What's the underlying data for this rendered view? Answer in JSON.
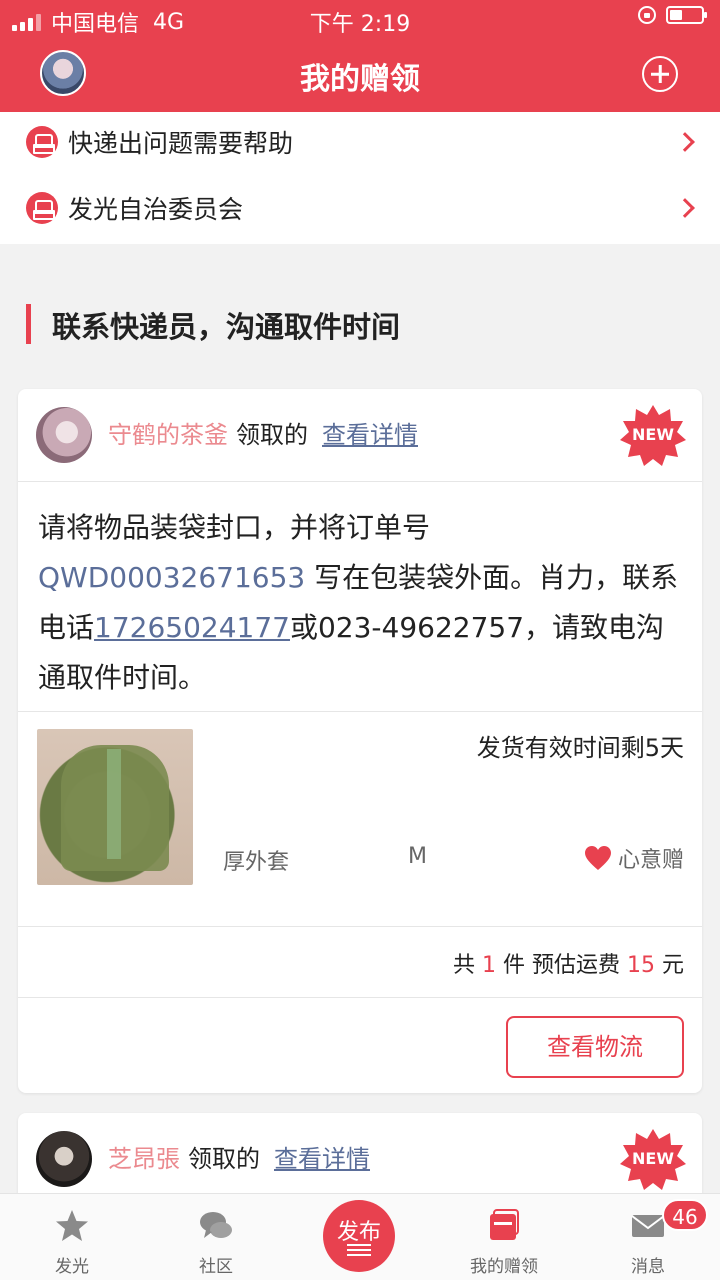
{
  "status_bar": {
    "carrier": "中国电信",
    "network": "4G",
    "time": "下午 2:19"
  },
  "header": {
    "title": "我的赠领",
    "left_icon": "user-avatar",
    "right_icon": "add-circle-icon"
  },
  "help_menu": {
    "items": [
      {
        "label": "快递出问题需要帮助",
        "icon": "courier-icon"
      },
      {
        "label": "发光自治委员会",
        "icon": "courier-icon"
      }
    ]
  },
  "section": {
    "title": "联系快递员，沟通取件时间"
  },
  "cards": [
    {
      "username": "守鹤的茶釜",
      "claimed_label": "领取的",
      "detail_link": "查看详情",
      "badge": "NEW",
      "message": {
        "part1": "请将物品装袋封口，并将订单号 ",
        "order_no": "QWD00032671653",
        "part2": " 写在包装袋外面。肖力，联系电话",
        "phone": "17265024177",
        "part3": "或023-49622757，请致电沟通取件时间。"
      },
      "ship_time": "发货有效时间剩5天",
      "item_name": "厚外套",
      "item_size": "M",
      "gift_type": "心意赠",
      "summary": {
        "prefix": "共 ",
        "count": "1",
        "middle": " 件 预估运费 ",
        "fee": "15",
        "suffix": " 元"
      },
      "track_button": "查看物流"
    },
    {
      "username": "芝昂張",
      "claimed_label": "领取的",
      "detail_link": "查看详情",
      "badge": "NEW"
    }
  ],
  "tabbar": {
    "tabs": [
      {
        "label": "发光",
        "icon": "star-icon",
        "active": false
      },
      {
        "label": "社区",
        "icon": "chat-bubbles-icon",
        "active": false
      },
      {
        "label": "发布",
        "icon": "publish-icon",
        "active": false
      },
      {
        "label": "我的赠领",
        "icon": "gift-box-icon",
        "active": true
      },
      {
        "label": "消息",
        "icon": "mail-icon",
        "active": false
      }
    ],
    "message_badge": "46"
  },
  "colors": {
    "brand": "#e8414f",
    "link": "#5b6e99",
    "username": "#eb8a8f"
  }
}
